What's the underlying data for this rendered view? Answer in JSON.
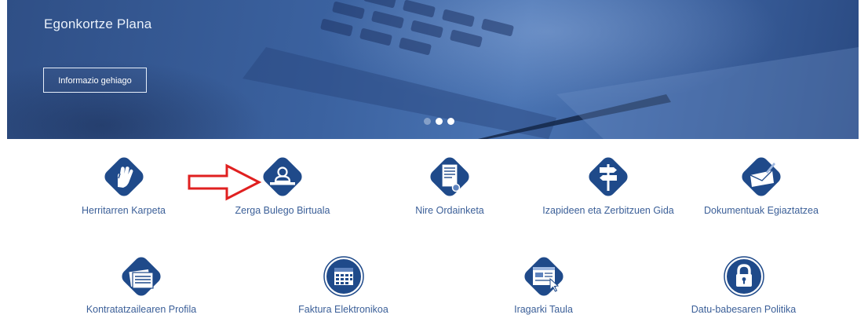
{
  "banner": {
    "title": "Egonkortze Plana",
    "button_label": "Informazio gehiago",
    "slides_total": 3,
    "active_slide": 1
  },
  "tiles": [
    {
      "label": "Herritarren Karpeta",
      "icon": "hand-icon"
    },
    {
      "label": "Zerga Bulego Birtuala",
      "icon": "person-counter-icon"
    },
    {
      "label": "Nire Ordainketa",
      "icon": "document-seal-icon"
    },
    {
      "label": "Izapideen eta Zerbitzuen Gida",
      "icon": "signpost-icon"
    },
    {
      "label": "Dokumentuak Egiaztatzea",
      "icon": "envelope-pen-icon"
    },
    {
      "label": "Kontratatzailearen Profila",
      "icon": "files-icon"
    },
    {
      "label": "Faktura Elektronikoa",
      "icon": "calendar-icon"
    },
    {
      "label": "Iragarki Taula",
      "icon": "browser-cursor-icon"
    },
    {
      "label": "Datu-babesaren Politika",
      "icon": "padlock-icon"
    }
  ],
  "annotation": {
    "icon": "red-outline-arrow-icon"
  },
  "colors": {
    "banner": "#3b62a0",
    "tile_bg": "#1f4a8a",
    "label": "#3b5f98",
    "arrow": "#e02020"
  }
}
